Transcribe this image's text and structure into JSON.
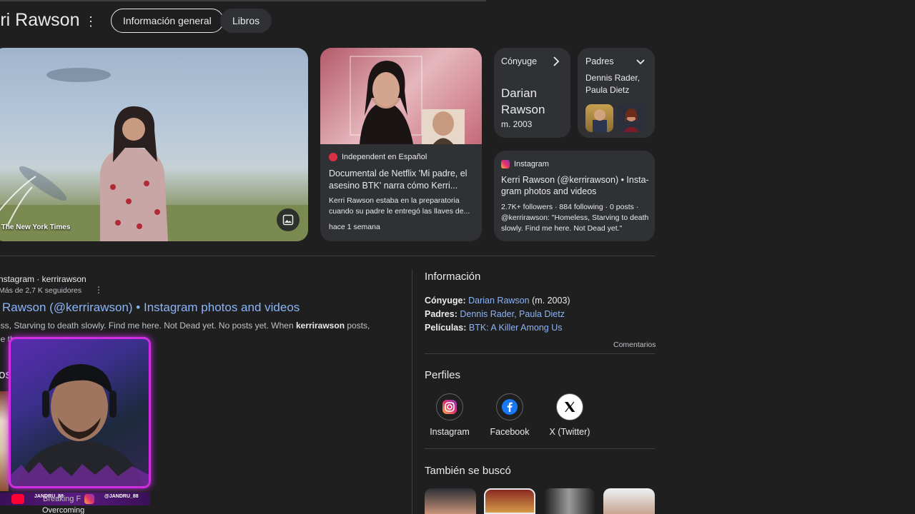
{
  "header": {
    "title": "rri Rawson",
    "more_icon": "kebab-menu-icon",
    "chips": [
      {
        "label": "Información general",
        "active": true
      },
      {
        "label": "Libros",
        "active": false
      }
    ]
  },
  "hero": {
    "credit": "e: The New York Times",
    "image_icon": "image-icon"
  },
  "news": {
    "source": "Independent en Español",
    "title": "Documental de Netflix 'Mi padre, el asesino BTK' narra cómo Kerri...",
    "snippet": "Kerri Rawson estaba en la preparatoria cuando su padre le entregó las llaves de...",
    "time": "hace 1 semana"
  },
  "spouse_card": {
    "label": "Cónyuge",
    "name": "Darian Rawson",
    "year": "m. 2003"
  },
  "parents_card": {
    "label": "Padres",
    "names": "Dennis Rader, Paula Dietz"
  },
  "instagram_card": {
    "source": "Instagram",
    "title": "Kerri Rawson (@kerrirawson) • Insta-gram photos and videos",
    "snippet": "2.7K+ followers · 884 following · 0 posts · @kerrirawson: \"Homeless, Starving to death slowly. Find me here. Not Dead yet.\""
  },
  "result": {
    "site": "nstagram · kerrirawson",
    "subtitle": "Más de 2,7 K seguidores",
    "title": "Rawson (@kerrirawson) • Instagram photos and videos",
    "snippet_a": "ess, Starving to death slowly. Find me here. Not Dead yet. No posts yet. When ",
    "snippet_bold": "kerrirawson",
    "snippet_b": " posts,",
    "snippet_line2": "ee th..."
  },
  "left_section_letter": "os",
  "stream": {
    "handle_left": "JANDRU_88",
    "handle_right": "@JANDRU_88",
    "overlay_text": "Breaking F",
    "caption": "Overcoming"
  },
  "info": {
    "heading": "Información",
    "rows": [
      {
        "key": "Cónyuge:",
        "value": "Darian Rawson",
        "extra": " (m. 2003)"
      },
      {
        "key": "Padres:",
        "value": "Dennis Rader, Paula Dietz",
        "extra": ""
      },
      {
        "key": "Películas:",
        "value": "BTK: A Killer Among Us",
        "extra": ""
      }
    ],
    "feedback": "Comentarios"
  },
  "profiles": {
    "heading": "Perfiles",
    "items": [
      {
        "label": "Instagram",
        "icon": "instagram-icon"
      },
      {
        "label": "Facebook",
        "icon": "facebook-icon"
      },
      {
        "label": "X (Twitter)",
        "icon": "x-twitter-icon"
      }
    ]
  },
  "also_searched": {
    "heading": "También se buscó"
  },
  "colors": {
    "background": "#1f1f1f",
    "card": "#303134",
    "link": "#8ab4f8",
    "webcam_border": "#d12ee3"
  }
}
